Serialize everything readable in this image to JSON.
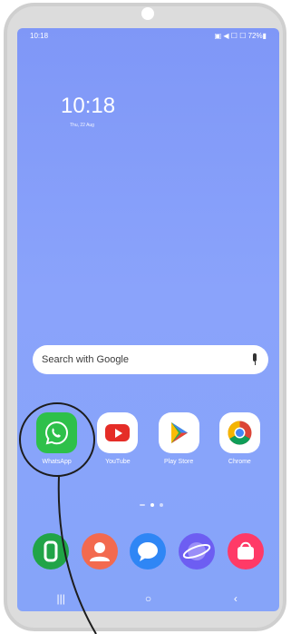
{
  "status_bar": {
    "time": "10:18",
    "right_text": "▣ ◀ ☐ ☐ 72%▮"
  },
  "lockscreen": {
    "clock": "10:18",
    "date": "Thu, 22 Aug"
  },
  "search": {
    "label": "Search with Google"
  },
  "apps": [
    {
      "name": "WhatsApp"
    },
    {
      "name": "YouTube"
    },
    {
      "name": "Play Store"
    },
    {
      "name": "Chrome"
    }
  ],
  "dock": [
    "Phone",
    "Contacts",
    "Messages",
    "Internet",
    "Galaxy Store"
  ]
}
